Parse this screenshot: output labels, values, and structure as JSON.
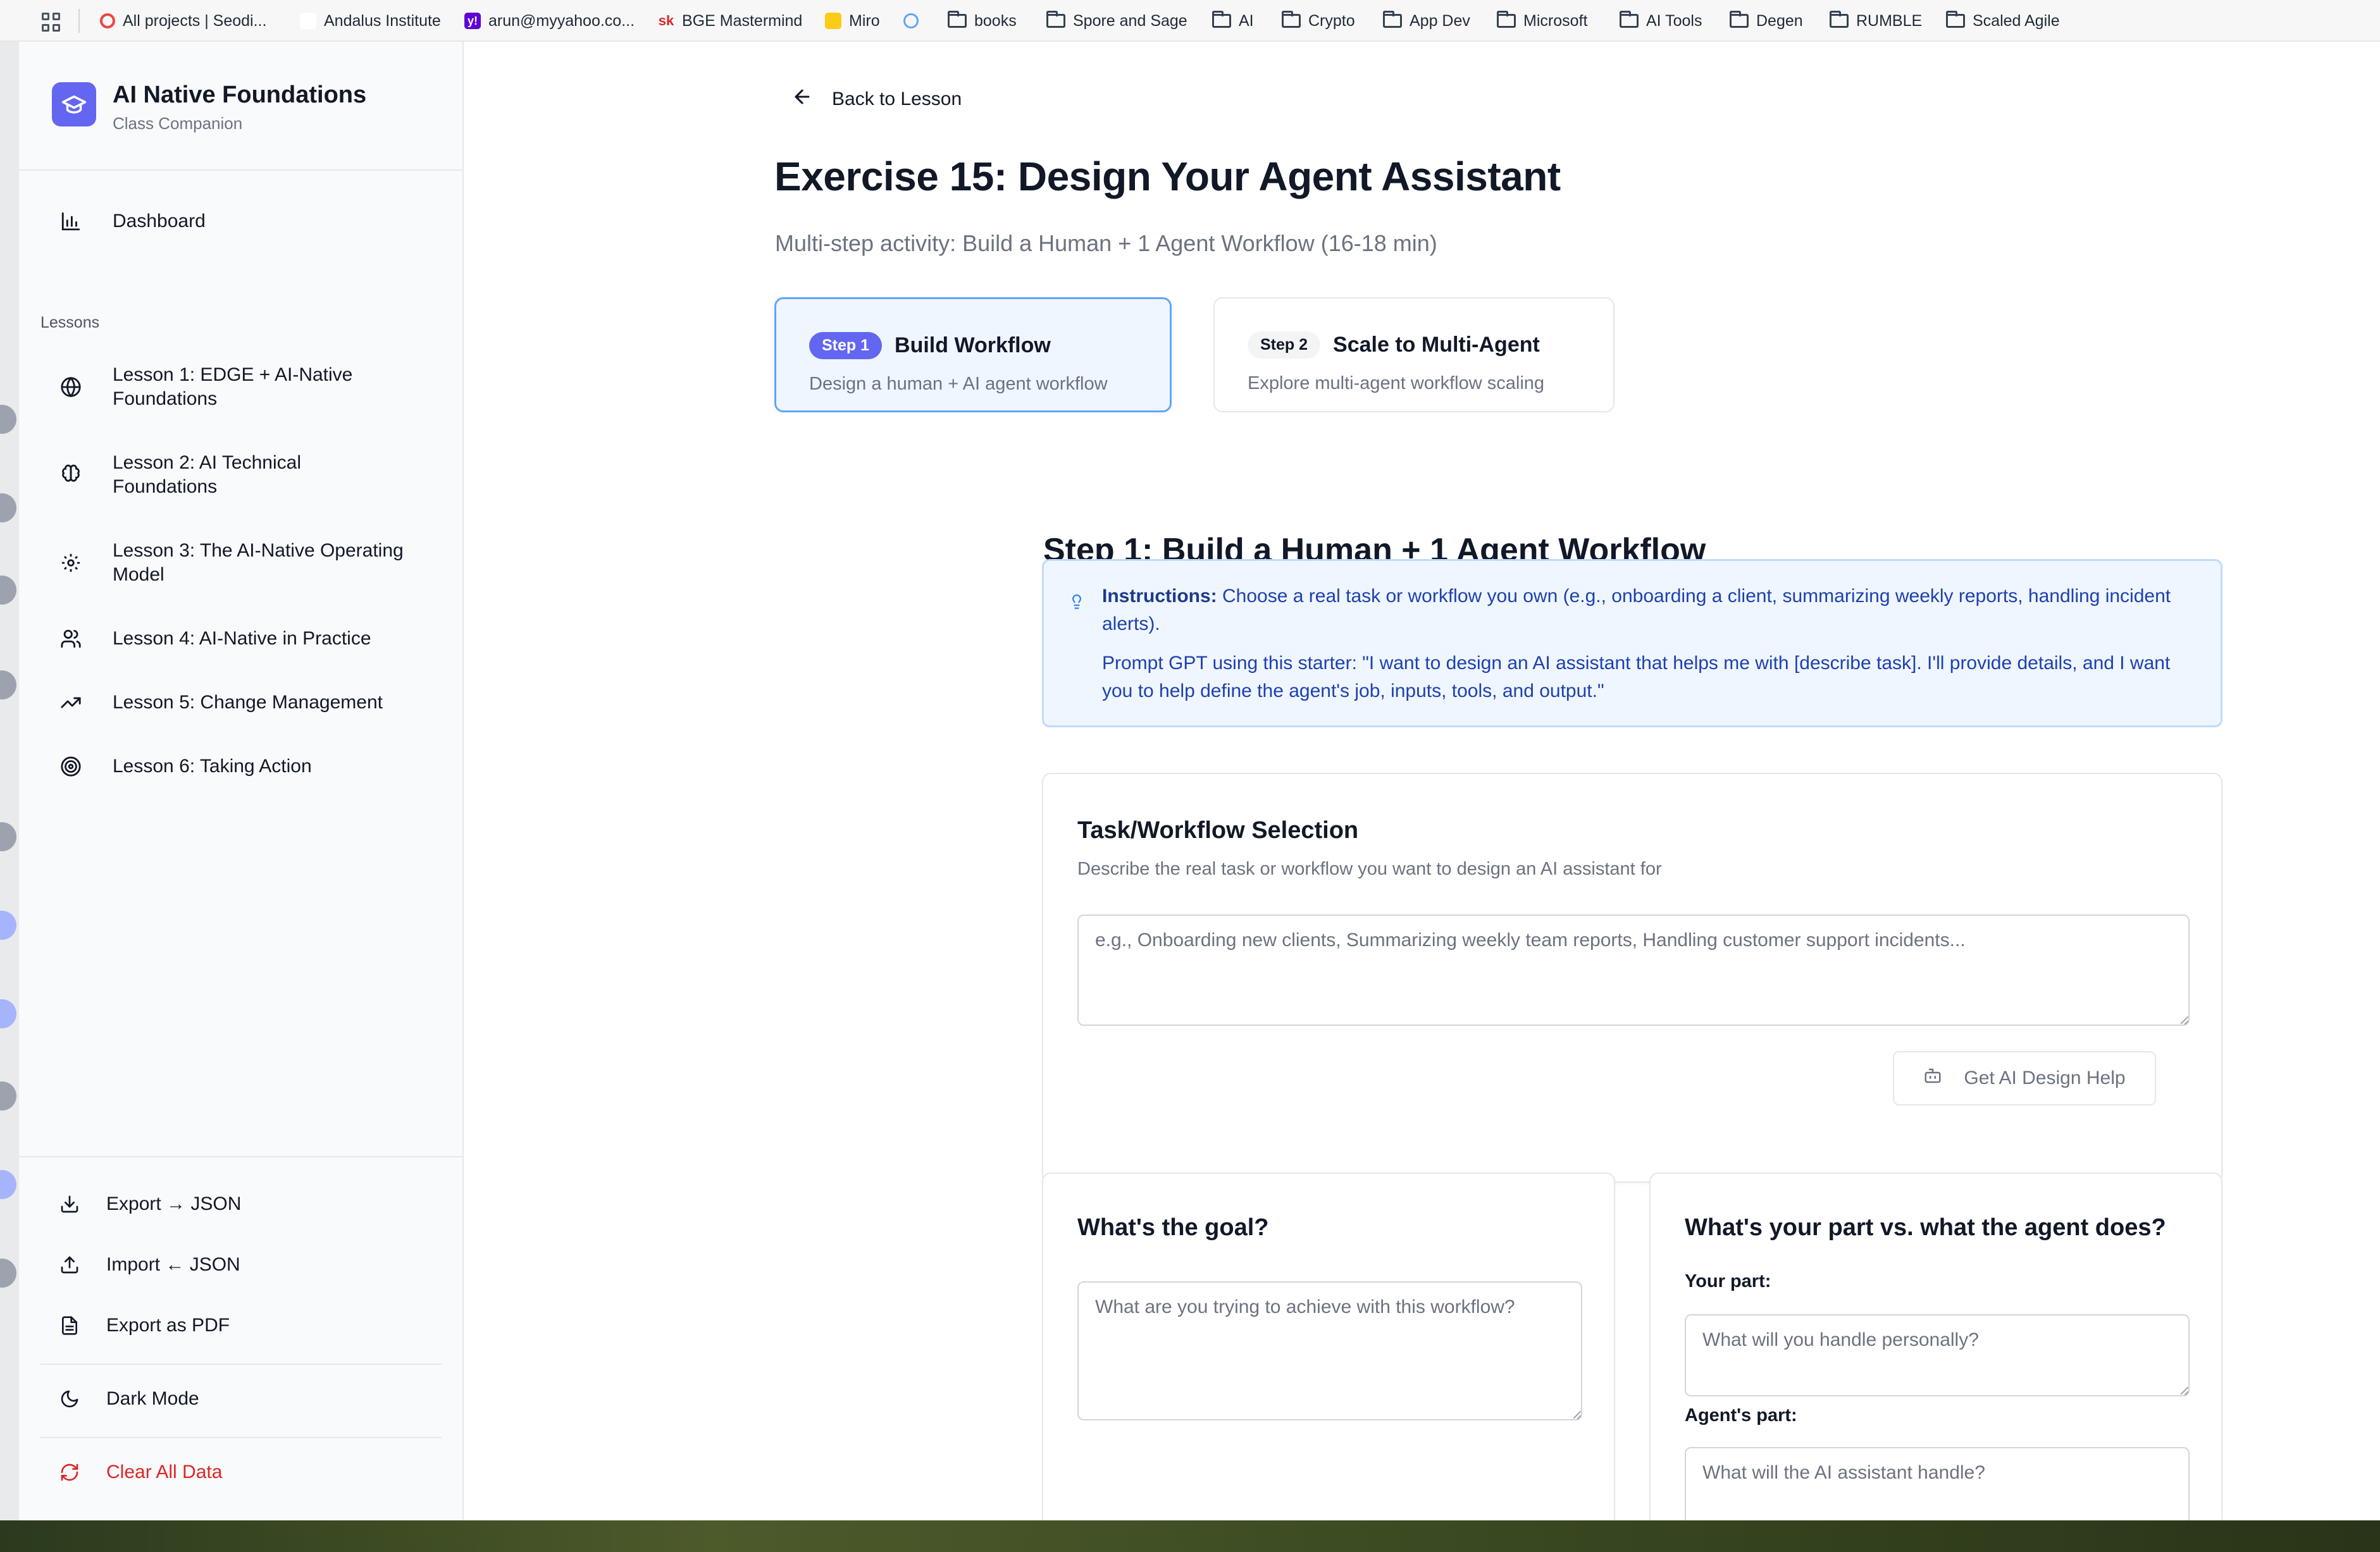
{
  "bookmarks": [
    {
      "label": "All projects | Seodi...",
      "type": "site",
      "color": "#ef4444"
    },
    {
      "label": "Andalus Institute",
      "type": "site",
      "color": "#ffffff"
    },
    {
      "label": "arun@myyahoo.co...",
      "type": "site",
      "color": "#6001d2"
    },
    {
      "label": "BGE Mastermind",
      "type": "site",
      "color": "#dc2626"
    },
    {
      "label": "Miro",
      "type": "site",
      "color": "#facc15"
    },
    {
      "label": "",
      "type": "site",
      "color": "#60a5fa"
    },
    {
      "label": "books",
      "type": "folder"
    },
    {
      "label": "Spore and Sage",
      "type": "folder"
    },
    {
      "label": "AI",
      "type": "folder"
    },
    {
      "label": "Crypto",
      "type": "folder"
    },
    {
      "label": "App Dev",
      "type": "folder"
    },
    {
      "label": "Microsoft",
      "type": "folder"
    },
    {
      "label": "AI Tools",
      "type": "folder"
    },
    {
      "label": "Degen",
      "type": "folder"
    },
    {
      "label": "RUMBLE",
      "type": "folder"
    },
    {
      "label": "Scaled Agile",
      "type": "folder"
    }
  ],
  "sidebar": {
    "brand_title": "AI Native Foundations",
    "brand_subtitle": "Class Companion",
    "dashboard_label": "Dashboard",
    "lessons_heading": "Lessons",
    "lessons": [
      {
        "label": "Lesson 1: EDGE + AI-Native Foundations",
        "icon": "globe-icon"
      },
      {
        "label": "Lesson 2: AI Technical Foundations",
        "icon": "brain-icon"
      },
      {
        "label": "Lesson 3: The AI-Native Operating Model",
        "icon": "gear-icon"
      },
      {
        "label": "Lesson 4: AI-Native in Practice",
        "icon": "users-icon"
      },
      {
        "label": "Lesson 5: Change Management",
        "icon": "trending-up-icon"
      },
      {
        "label": "Lesson 6: Taking Action",
        "icon": "target-icon"
      }
    ],
    "footer": {
      "export_json": "Export → JSON",
      "import_json": "Import ← JSON",
      "export_pdf": "Export as PDF",
      "dark_mode": "Dark Mode",
      "clear_data": "Clear All Data"
    }
  },
  "main": {
    "back_label": "Back to Lesson",
    "title": "Exercise 15: Design Your Agent Assistant",
    "subtitle": "Multi-step activity: Build a Human + 1 Agent Workflow (16-18 min)",
    "steps": [
      {
        "badge": "Step 1",
        "name": "Build Workflow",
        "desc": "Design a human + AI agent workflow",
        "active": true
      },
      {
        "badge": "Step 2",
        "name": "Scale to Multi-Agent",
        "desc": "Explore multi-agent workflow scaling",
        "active": false
      }
    ],
    "section_title": "Step 1: Build a Human + 1 Agent Workflow",
    "instructions": {
      "label": "Instructions:",
      "text": " Choose a real task or workflow you own (e.g., onboarding a client, summarizing weekly reports, handling incident alerts).",
      "prompt": "Prompt GPT using this starter: \"I want to design an AI assistant that helps me with [describe task]. I'll provide details, and I want you to help define the agent's job, inputs, tools, and output.\""
    },
    "task_card": {
      "title": "Task/Workflow Selection",
      "desc": "Describe the real task or workflow you want to design an AI assistant for",
      "placeholder": "e.g., Onboarding new clients, Summarizing weekly team reports, Handling customer support incidents...",
      "value": "",
      "button_label": "Get AI Design Help"
    },
    "goal_card": {
      "title": "What's the goal?",
      "placeholder": "What are you trying to achieve with this workflow?",
      "value": ""
    },
    "parts_card": {
      "title": "What's your part vs. what the agent does?",
      "your_part_label": "Your part:",
      "your_part_placeholder": "What will you handle personally?",
      "agent_part_label": "Agent's part:",
      "agent_part_placeholder": "What will the AI assistant handle?"
    }
  },
  "colors": {
    "accent": "#6366f1",
    "active_step_bg": "#eff6ff",
    "active_step_border": "#60a5fa",
    "instruction_text": "#1e40af",
    "danger": "#dc2626"
  }
}
